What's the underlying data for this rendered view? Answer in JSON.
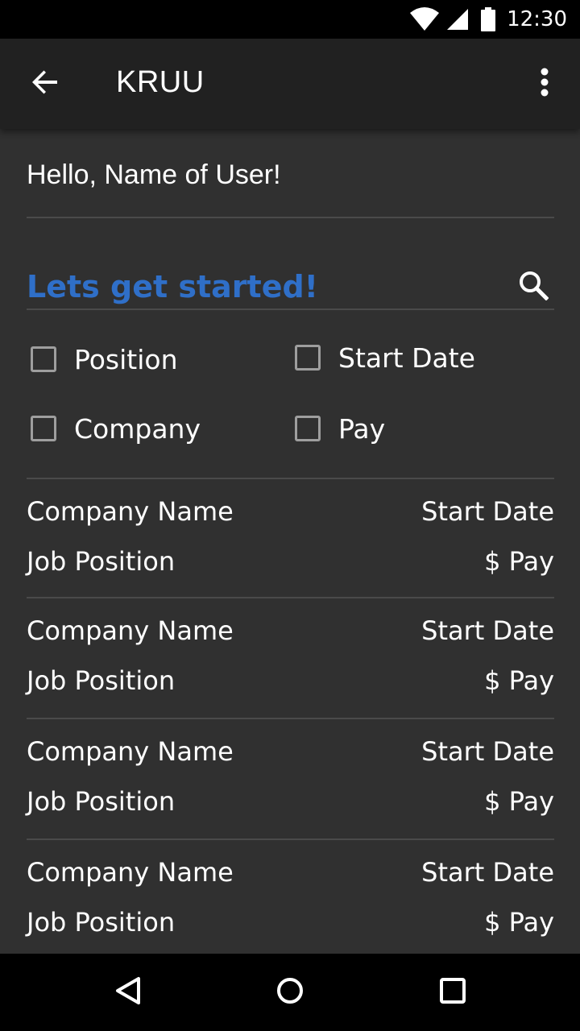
{
  "status_bar": {
    "time": "12:30",
    "icons": [
      "wifi-icon",
      "cellular-signal-icon",
      "battery-icon"
    ]
  },
  "app_bar": {
    "title": "KRUU",
    "back_icon": "arrow-back-icon",
    "menu_icon": "more-vert-icon"
  },
  "greeting": "Hello, Name of User!",
  "search": {
    "placeholder": "Lets get started!",
    "value": "",
    "icon": "search-icon"
  },
  "filters": [
    {
      "label": "Position",
      "checked": false
    },
    {
      "label": "Start Date",
      "checked": false
    },
    {
      "label": "Company",
      "checked": false
    },
    {
      "label": "Pay",
      "checked": false
    }
  ],
  "listings": [
    {
      "company": "Company Name",
      "position": "Job Position",
      "start_date": "Start Date",
      "pay": "$ Pay"
    },
    {
      "company": "Company Name",
      "position": "Job Position",
      "start_date": "Start Date",
      "pay": "$ Pay"
    },
    {
      "company": "Company Name",
      "position": "Job Position",
      "start_date": "Start Date",
      "pay": "$ Pay"
    },
    {
      "company": "Company Name",
      "position": "Job Position",
      "start_date": "Start Date",
      "pay": "$ Pay"
    }
  ],
  "nav_bar": {
    "icons": [
      "back-triangle-icon",
      "home-circle-icon",
      "recents-square-icon"
    ]
  },
  "colors": {
    "background": "#303030",
    "app_bar": "#212121",
    "accent": "#2f6fc8",
    "divider": "#4a4a4a",
    "text": "#ffffff"
  }
}
